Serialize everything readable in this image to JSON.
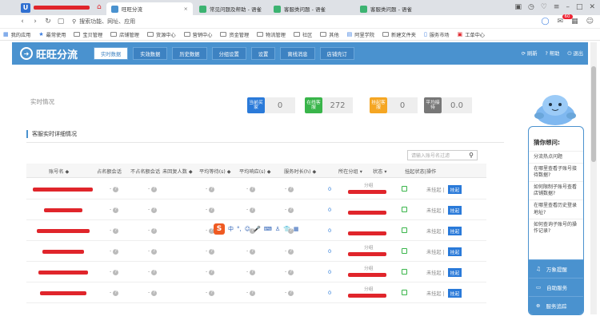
{
  "browser": {
    "tabs": [
      {
        "label": "旺旺分流",
        "active": true
      },
      {
        "label": "常见问题及帮助 - 语雀",
        "active": false
      },
      {
        "label": "客服类问题 - 语雀",
        "active": false
      },
      {
        "label": "客服类问题 - 语雀",
        "active": false
      }
    ],
    "tab_close": "×",
    "url_placeholder": "搜索功能、网址、应用",
    "notification_count": "60"
  },
  "bookmarks": [
    {
      "label": "我的应用",
      "icon": "apps-icon"
    },
    {
      "label": "最常使用",
      "icon": "star-icon"
    },
    {
      "label": "宝贝管理",
      "icon": "folder-icon"
    },
    {
      "label": "店铺管理",
      "icon": "folder-icon"
    },
    {
      "label": "货源中心",
      "icon": "folder-icon"
    },
    {
      "label": "营销中心",
      "icon": "folder-icon"
    },
    {
      "label": "资金管理",
      "icon": "folder-icon"
    },
    {
      "label": "物流管理",
      "icon": "folder-icon"
    },
    {
      "label": "社区",
      "icon": "folder-icon"
    },
    {
      "label": "其他",
      "icon": "folder-icon"
    },
    {
      "label": "阿里学院",
      "icon": "link-icon"
    },
    {
      "label": "新建文件夹",
      "icon": "folder-icon"
    },
    {
      "label": "服务市场",
      "icon": "file-icon"
    },
    {
      "label": "工单中心",
      "icon": "ticket-icon"
    }
  ],
  "app": {
    "logo_text": "旺旺分流",
    "nav_tabs": [
      "实时数据",
      "实效数据",
      "历史数据",
      "分组设置",
      "设置",
      "离线消息",
      "店铺壳订"
    ],
    "active_tab": 0,
    "header_links": [
      "刷新",
      "帮助",
      "退出"
    ]
  },
  "realtime": {
    "title": "实时情况",
    "stats": [
      {
        "label": "当前买家",
        "value": "0",
        "color": "#2a7ad9"
      },
      {
        "label": "在线客服",
        "value": "272",
        "color": "#39b54a"
      },
      {
        "label": "挂起客服",
        "value": "0",
        "color": "#f5a623"
      },
      {
        "label": "平均接待",
        "value": "0.0",
        "color": "#777777"
      }
    ]
  },
  "detail": {
    "section_title": "客服实时详细情况",
    "search_placeholder": "请输入账号名过滤",
    "columns": [
      "账号名 ◆",
      "占名额会话",
      "不占名额会话",
      "未回复人数 ◆",
      "平均等待(s) ◆",
      "平均响应(s) ◆",
      "服务时长(h) ◆",
      "所在分组 ▾",
      "状态 ▾",
      "挂起状态|操作"
    ],
    "rows": [
      {
        "group": "分组",
        "service_hours": "0",
        "status_text": "未挂起",
        "action": "挂起"
      },
      {
        "group": "",
        "service_hours": "0",
        "status_text": "未挂起",
        "action": "挂起"
      },
      {
        "group": "",
        "service_hours": "0",
        "status_text": "未挂起",
        "action": "挂起"
      },
      {
        "group": "分组",
        "service_hours": "0",
        "status_text": "未挂起",
        "action": "挂起"
      },
      {
        "group": "分组",
        "service_hours": "0",
        "status_text": "未挂起",
        "action": "挂起"
      },
      {
        "group": "分组",
        "service_hours": "0",
        "status_text": "未挂起",
        "action": "挂起"
      }
    ],
    "dash": "-",
    "status_sep": "|"
  },
  "ime_toolbar": {
    "logo": "S",
    "items": [
      "中",
      "°,",
      "☺",
      "🎤",
      "⌨",
      "♙",
      "👕",
      "▦"
    ]
  },
  "assistant": {
    "title": "猜你想问:",
    "questions": [
      "分流热点问题",
      "在哪里查看子账号接待数据?",
      "如何限制子账号查看店铺数据?",
      "在哪里查看历史登录地址?",
      "如何查询子账号的操作记录?"
    ],
    "buttons": [
      {
        "label": "万象提醒",
        "icon": "bell-icon"
      },
      {
        "label": "自助服务",
        "icon": "chat-icon"
      },
      {
        "label": "服务追踪",
        "icon": "track-icon"
      }
    ]
  },
  "colors": {
    "brand": "#4a92cf",
    "link": "#2a7ad9",
    "redact": "#e0252b"
  }
}
